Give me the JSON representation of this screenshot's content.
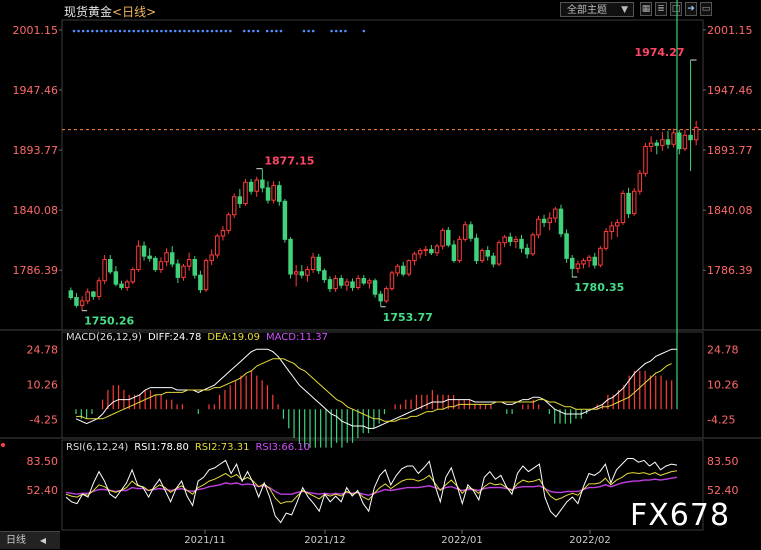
{
  "header": {
    "instrument": "现货黄金",
    "interval": "<日线>",
    "theme_button": "全部主题",
    "toolbar_icons": [
      "grid-icon",
      "bars-icon",
      "box-icon",
      "arrow-right-icon",
      "dual-screen-icon"
    ]
  },
  "colors": {
    "up": "#ff3b3b",
    "down": "#3fd27a",
    "price_line": "#ff8a3b",
    "diff_line": "#ffffff",
    "dea_line": "#e6dc3a",
    "rsi3_line": "#c040e0",
    "axis_text_red": "#ff6a6a"
  },
  "price_axis": {
    "ticks": [
      "2001.15",
      "1947.46",
      "1893.77",
      "1840.08",
      "1786.39"
    ],
    "ticks_num": [
      2001.15,
      1947.46,
      1893.77,
      1840.08,
      1786.39
    ]
  },
  "annotations": [
    {
      "label": "1974.27",
      "color": "#ff4466"
    },
    {
      "label": "1877.15",
      "color": "#ff4466"
    },
    {
      "label": "1750.26",
      "color": "#44dd88"
    },
    {
      "label": "1753.77",
      "color": "#44dd88"
    },
    {
      "label": "1780.35",
      "color": "#44dd88"
    }
  ],
  "macd": {
    "legend": "MACD(26,12,9)",
    "diff_label": "DIFF:24.78",
    "dea_label": "DEA:19.09",
    "macd_label": "MACD:11.37",
    "axis": [
      "24.78",
      "10.26",
      "-4.25"
    ]
  },
  "rsi": {
    "legend": "RSI(6,12,24)",
    "rsi1_label": "RSI1:78.80",
    "rsi2_label": "RSI2:73.31",
    "rsi3_label": "RSI3:66.10",
    "axis": [
      "83.50",
      "52.40"
    ]
  },
  "x_axis": {
    "labels": [
      "2021/11",
      "2021/12",
      "2022/01",
      "2022/02"
    ]
  },
  "footer": {
    "period_tab": "日线"
  },
  "watermark": "FX678",
  "chart_data": {
    "type": "candlestick",
    "title": "现货黄金 <日线>",
    "ylim": [
      1733,
      2010
    ],
    "candles": [
      [
        1768,
        1771,
        1760,
        1762
      ],
      [
        1762,
        1766,
        1753,
        1755
      ],
      [
        1755,
        1763,
        1750,
        1759
      ],
      [
        1759,
        1770,
        1756,
        1767
      ],
      [
        1767,
        1768,
        1760,
        1763
      ],
      [
        1763,
        1780,
        1760,
        1777
      ],
      [
        1777,
        1800,
        1774,
        1796
      ],
      [
        1796,
        1800,
        1783,
        1785
      ],
      [
        1785,
        1790,
        1772,
        1774
      ],
      [
        1774,
        1777,
        1769,
        1771
      ],
      [
        1771,
        1778,
        1768,
        1776
      ],
      [
        1776,
        1789,
        1774,
        1787
      ],
      [
        1787,
        1813,
        1785,
        1808
      ],
      [
        1808,
        1812,
        1795,
        1799
      ],
      [
        1799,
        1806,
        1794,
        1797
      ],
      [
        1797,
        1799,
        1785,
        1787
      ],
      [
        1787,
        1798,
        1784,
        1794
      ],
      [
        1794,
        1806,
        1790,
        1802
      ],
      [
        1802,
        1808,
        1789,
        1792
      ],
      [
        1792,
        1796,
        1775,
        1780
      ],
      [
        1780,
        1792,
        1777,
        1790
      ],
      [
        1790,
        1802,
        1786,
        1796
      ],
      [
        1796,
        1799,
        1779,
        1782
      ],
      [
        1782,
        1786,
        1766,
        1769
      ],
      [
        1769,
        1797,
        1767,
        1795
      ],
      [
        1795,
        1805,
        1791,
        1800
      ],
      [
        1800,
        1819,
        1797,
        1817
      ],
      [
        1817,
        1826,
        1813,
        1822
      ],
      [
        1822,
        1838,
        1819,
        1836
      ],
      [
        1836,
        1855,
        1833,
        1852
      ],
      [
        1852,
        1859,
        1842,
        1846
      ],
      [
        1846,
        1868,
        1844,
        1865
      ],
      [
        1865,
        1868,
        1854,
        1857
      ],
      [
        1857,
        1870,
        1852,
        1867
      ],
      [
        1867,
        1877,
        1856,
        1860
      ],
      [
        1860,
        1866,
        1846,
        1849
      ],
      [
        1849,
        1866,
        1846,
        1862
      ],
      [
        1862,
        1866,
        1844,
        1848
      ],
      [
        1848,
        1850,
        1811,
        1814
      ],
      [
        1814,
        1816,
        1779,
        1783
      ],
      [
        1783,
        1791,
        1772,
        1785
      ],
      [
        1785,
        1791,
        1779,
        1782
      ],
      [
        1782,
        1790,
        1776,
        1787
      ],
      [
        1787,
        1802,
        1784,
        1798
      ],
      [
        1798,
        1801,
        1783,
        1786
      ],
      [
        1786,
        1788,
        1775,
        1778
      ],
      [
        1778,
        1781,
        1767,
        1770
      ],
      [
        1770,
        1782,
        1767,
        1779
      ],
      [
        1779,
        1782,
        1770,
        1773
      ],
      [
        1773,
        1779,
        1768,
        1776
      ],
      [
        1776,
        1779,
        1768,
        1771
      ],
      [
        1771,
        1782,
        1769,
        1779
      ],
      [
        1779,
        1782,
        1773,
        1775
      ],
      [
        1775,
        1779,
        1770,
        1777
      ],
      [
        1777,
        1779,
        1762,
        1765
      ],
      [
        1765,
        1768,
        1754,
        1759
      ],
      [
        1759,
        1772,
        1757,
        1770
      ],
      [
        1770,
        1786,
        1768,
        1784
      ],
      [
        1784,
        1792,
        1781,
        1790
      ],
      [
        1790,
        1794,
        1781,
        1783
      ],
      [
        1783,
        1796,
        1781,
        1795
      ],
      [
        1795,
        1803,
        1791,
        1801
      ],
      [
        1801,
        1806,
        1797,
        1804
      ],
      [
        1804,
        1808,
        1799,
        1805
      ],
      [
        1805,
        1809,
        1800,
        1802
      ],
      [
        1802,
        1810,
        1799,
        1808
      ],
      [
        1808,
        1824,
        1805,
        1822
      ],
      [
        1822,
        1825,
        1807,
        1809
      ],
      [
        1809,
        1813,
        1793,
        1795
      ],
      [
        1795,
        1817,
        1793,
        1814
      ],
      [
        1814,
        1830,
        1812,
        1827
      ],
      [
        1827,
        1830,
        1812,
        1815
      ],
      [
        1815,
        1819,
        1792,
        1795
      ],
      [
        1795,
        1806,
        1793,
        1804
      ],
      [
        1804,
        1808,
        1795,
        1799
      ],
      [
        1799,
        1802,
        1789,
        1792
      ],
      [
        1792,
        1813,
        1790,
        1811
      ],
      [
        1811,
        1818,
        1807,
        1816
      ],
      [
        1816,
        1820,
        1808,
        1812
      ],
      [
        1812,
        1817,
        1806,
        1814
      ],
      [
        1814,
        1818,
        1802,
        1806
      ],
      [
        1806,
        1810,
        1797,
        1801
      ],
      [
        1801,
        1820,
        1799,
        1818
      ],
      [
        1818,
        1835,
        1815,
        1832
      ],
      [
        1832,
        1836,
        1825,
        1829
      ],
      [
        1829,
        1838,
        1822,
        1833
      ],
      [
        1833,
        1843,
        1829,
        1841
      ],
      [
        1841,
        1845,
        1816,
        1819
      ],
      [
        1819,
        1823,
        1793,
        1797
      ],
      [
        1797,
        1800,
        1780,
        1788
      ],
      [
        1788,
        1795,
        1784,
        1792
      ],
      [
        1792,
        1797,
        1788,
        1795
      ],
      [
        1795,
        1800,
        1789,
        1798
      ],
      [
        1798,
        1802,
        1788,
        1791
      ],
      [
        1791,
        1808,
        1789,
        1806
      ],
      [
        1806,
        1824,
        1804,
        1821
      ],
      [
        1821,
        1830,
        1814,
        1826
      ],
      [
        1826,
        1832,
        1816,
        1829
      ],
      [
        1829,
        1858,
        1827,
        1855
      ],
      [
        1855,
        1860,
        1833,
        1837
      ],
      [
        1837,
        1860,
        1835,
        1857
      ],
      [
        1857,
        1876,
        1854,
        1873
      ],
      [
        1873,
        1900,
        1870,
        1897
      ],
      [
        1897,
        1906,
        1892,
        1900
      ],
      [
        1900,
        1903,
        1890,
        1898
      ],
      [
        1898,
        1910,
        1893,
        1903
      ],
      [
        1903,
        1911,
        1895,
        1899
      ],
      [
        1899,
        1913,
        1896,
        1909
      ],
      [
        1909,
        1912,
        1890,
        1895
      ],
      [
        1895,
        1912,
        1893,
        1907
      ],
      [
        1907,
        1974,
        1875,
        1903
      ],
      [
        1903,
        1920,
        1898,
        1914
      ]
    ],
    "last_price": 1912,
    "highs_lows": [
      {
        "label": "1974.27",
        "value": 1974.27,
        "index": 110
      },
      {
        "label": "1877.15",
        "value": 1877.15,
        "index": 34
      },
      {
        "label": "1750.26",
        "value": 1750.26,
        "index": 2
      },
      {
        "label": "1753.77",
        "value": 1753.77,
        "index": 55
      },
      {
        "label": "1780.35",
        "value": 1780.35,
        "index": 89
      }
    ],
    "macd": {
      "diff": [
        -4,
        -5,
        -6,
        -5,
        -4,
        -2,
        1,
        3,
        4,
        4,
        4,
        5,
        6,
        8,
        9,
        9,
        9,
        9,
        9,
        8,
        8,
        8,
        8,
        7,
        8,
        9,
        10,
        12,
        14,
        16,
        18,
        20,
        22,
        24,
        25,
        25,
        25,
        24,
        22,
        19,
        16,
        13,
        10,
        8,
        6,
        4,
        2,
        0,
        -2,
        -3,
        -5,
        -6,
        -7,
        -7,
        -7,
        -8,
        -8,
        -7,
        -6,
        -5,
        -4,
        -3,
        -2,
        -1,
        0,
        1,
        2,
        3,
        3,
        3,
        4,
        4,
        4,
        4,
        4,
        3,
        3,
        3,
        3,
        3,
        3,
        2,
        2,
        3,
        4,
        4,
        5,
        5,
        4,
        2,
        0,
        -1,
        -2,
        -2,
        -2,
        -2,
        -1,
        0,
        1,
        2,
        4,
        5,
        7,
        9,
        12,
        15,
        17,
        19,
        20,
        22,
        23,
        24,
        25,
        25
      ],
      "dea": [
        -3,
        -3,
        -4,
        -4,
        -4,
        -4,
        -3,
        -2,
        -1,
        0,
        1,
        2,
        3,
        4,
        5,
        6,
        6,
        7,
        7,
        7,
        7,
        8,
        8,
        8,
        8,
        8,
        9,
        9,
        10,
        11,
        12,
        13,
        15,
        16,
        18,
        19,
        20,
        21,
        21,
        21,
        20,
        19,
        17,
        16,
        14,
        12,
        10,
        8,
        6,
        4,
        3,
        1,
        0,
        -1,
        -2,
        -3,
        -4,
        -4,
        -5,
        -5,
        -5,
        -4,
        -4,
        -3,
        -3,
        -2,
        -1,
        -1,
        0,
        0,
        1,
        1,
        2,
        2,
        2,
        2,
        2,
        2,
        2,
        3,
        3,
        3,
        3,
        3,
        3,
        3,
        3,
        4,
        4,
        3,
        3,
        2,
        1,
        1,
        0,
        0,
        0,
        0,
        0,
        1,
        1,
        2,
        3,
        4,
        5,
        7,
        9,
        11,
        13,
        15,
        16,
        18,
        19
      ]
    },
    "rsi": {
      "rsi1": [
        45,
        40,
        38,
        48,
        45,
        60,
        72,
        62,
        48,
        44,
        52,
        60,
        74,
        58,
        55,
        45,
        56,
        64,
        52,
        40,
        54,
        62,
        46,
        36,
        62,
        66,
        74,
        76,
        80,
        84,
        70,
        80,
        62,
        72,
        60,
        45,
        60,
        45,
        25,
        18,
        28,
        26,
        40,
        55,
        45,
        38,
        30,
        48,
        40,
        46,
        40,
        55,
        46,
        52,
        38,
        30,
        55,
        68,
        74,
        58,
        68,
        75,
        78,
        78,
        70,
        76,
        83,
        58,
        40,
        66,
        76,
        58,
        38,
        58,
        52,
        42,
        66,
        72,
        64,
        68,
        56,
        48,
        70,
        78,
        72,
        76,
        80,
        45,
        30,
        24,
        32,
        40,
        45,
        38,
        56,
        70,
        68,
        72,
        80,
        60,
        74,
        80,
        86,
        86,
        82,
        84,
        78,
        82,
        74,
        78,
        80,
        79
      ],
      "rsi2": [
        48,
        46,
        45,
        48,
        47,
        52,
        58,
        56,
        52,
        50,
        52,
        55,
        62,
        57,
        56,
        52,
        54,
        58,
        55,
        50,
        54,
        57,
        52,
        48,
        55,
        58,
        62,
        64,
        67,
        70,
        66,
        69,
        63,
        66,
        62,
        56,
        59,
        54,
        44,
        38,
        40,
        40,
        46,
        52,
        49,
        46,
        43,
        48,
        46,
        48,
        46,
        51,
        48,
        50,
        45,
        42,
        49,
        55,
        59,
        54,
        58,
        62,
        64,
        64,
        62,
        64,
        68,
        60,
        52,
        58,
        63,
        57,
        49,
        55,
        53,
        49,
        56,
        60,
        58,
        59,
        55,
        52,
        59,
        63,
        61,
        62,
        64,
        54,
        46,
        42,
        44,
        47,
        49,
        47,
        53,
        59,
        59,
        60,
        65,
        58,
        63,
        66,
        70,
        71,
        70,
        71,
        69,
        71,
        68,
        70,
        72,
        73
      ],
      "rsi3": [
        50,
        49,
        48,
        49,
        49,
        51,
        53,
        53,
        52,
        51,
        52,
        52,
        55,
        54,
        54,
        52,
        53,
        54,
        53,
        52,
        53,
        54,
        52,
        51,
        53,
        54,
        56,
        57,
        58,
        60,
        59,
        60,
        58,
        59,
        58,
        56,
        57,
        55,
        51,
        48,
        48,
        48,
        50,
        51,
        50,
        49,
        48,
        49,
        48,
        49,
        48,
        50,
        49,
        50,
        48,
        47,
        49,
        51,
        53,
        52,
        53,
        54,
        55,
        55,
        55,
        56,
        57,
        55,
        53,
        55,
        56,
        54,
        52,
        53,
        53,
        52,
        54,
        55,
        55,
        55,
        54,
        53,
        55,
        56,
        56,
        56,
        57,
        54,
        51,
        50,
        50,
        51,
        51,
        51,
        53,
        55,
        55,
        56,
        58,
        56,
        58,
        60,
        61,
        62,
        62,
        63,
        63,
        64,
        63,
        64,
        65,
        66
      ]
    },
    "series": [
      {
        "name": "DIFF",
        "value": 24.78
      },
      {
        "name": "DEA",
        "value": 19.09
      },
      {
        "name": "MACD",
        "value": 11.37
      },
      {
        "name": "RSI1",
        "value": 78.8
      },
      {
        "name": "RSI2",
        "value": 73.31
      },
      {
        "name": "RSI3",
        "value": 66.1
      }
    ],
    "x_labels": [
      "2021/11",
      "2021/12",
      "2022/01",
      "2022/02"
    ],
    "x_label_index": [
      36,
      72,
      104,
      140
    ]
  }
}
